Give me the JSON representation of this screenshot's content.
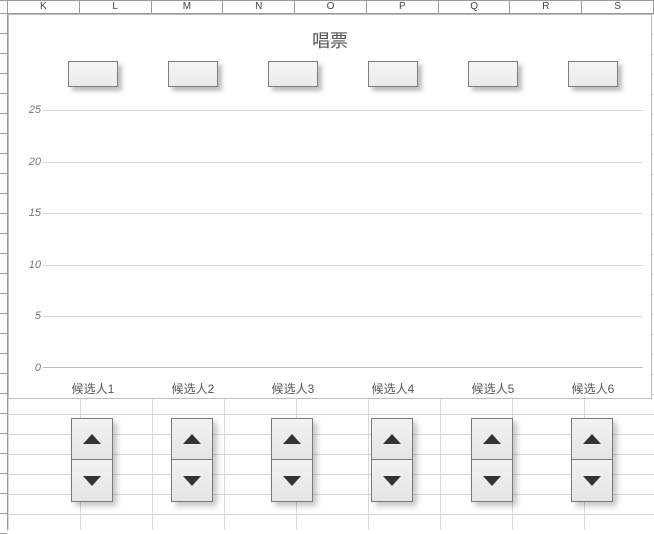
{
  "columns": [
    "K",
    "L",
    "M",
    "N",
    "O",
    "P",
    "Q",
    "R",
    "S"
  ],
  "chart": {
    "title": "唱票"
  },
  "chart_data": {
    "type": "bar",
    "title": "唱票",
    "categories": [
      "候选人1",
      "候选人2",
      "候选人3",
      "候选人4",
      "候选人5",
      "候选人6"
    ],
    "values": [
      0,
      0,
      0,
      0,
      0,
      0
    ],
    "ylabel": "",
    "xlabel": "",
    "ylim": [
      0,
      25
    ],
    "yticks": [
      0,
      5,
      10,
      15,
      20,
      25
    ]
  },
  "spinners": {
    "count": 6
  }
}
